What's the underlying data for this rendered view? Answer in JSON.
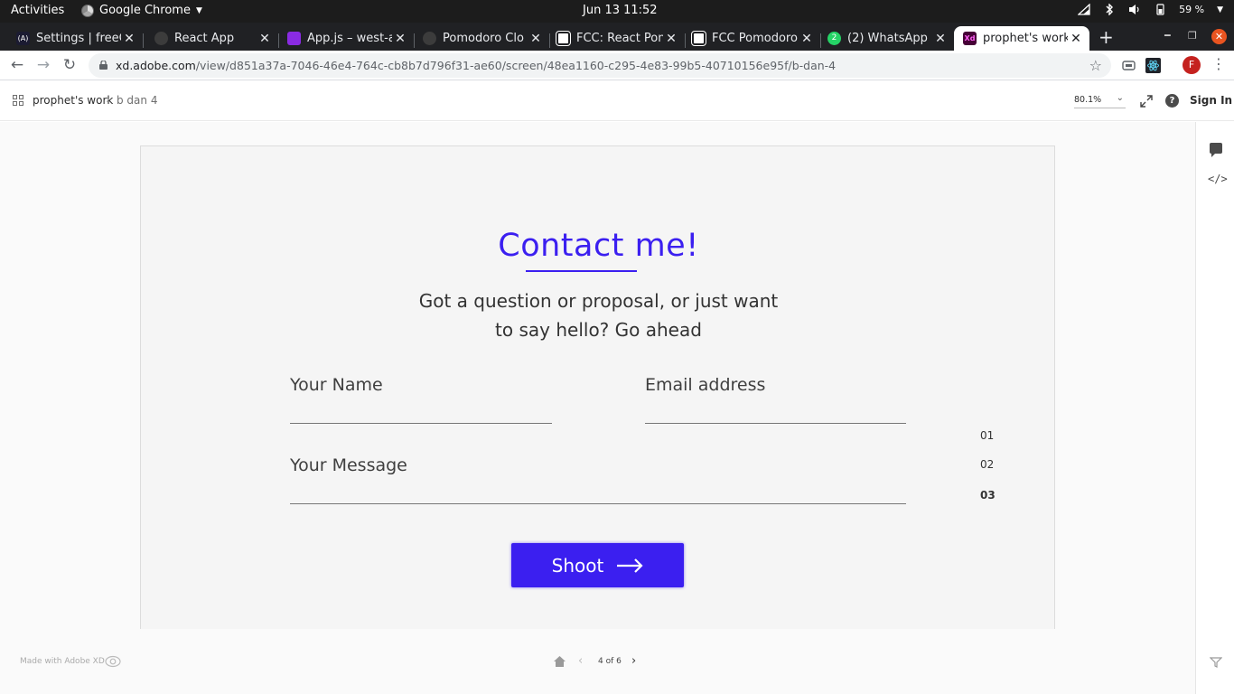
{
  "system_bar": {
    "activities": "Activities",
    "app_menu": "Google Chrome",
    "clock": "Jun 13  11:52",
    "battery": "59 %"
  },
  "tabs": [
    {
      "label": "Settings | freeC",
      "favicon_color": "#1b1b32"
    },
    {
      "label": "React App",
      "favicon_color": "#3c3c3c"
    },
    {
      "label": "App.js – west-a",
      "favicon_color": "#8a2be2"
    },
    {
      "label": "Pomodoro Clo",
      "favicon_color": "#3c3c3c"
    },
    {
      "label": "FCC: React Pon",
      "favicon_color": "#ffffff"
    },
    {
      "label": "FCC Pomodoro",
      "favicon_color": "#ffffff"
    },
    {
      "label": "(2) WhatsApp",
      "favicon_color": "#25d366",
      "badge": "2"
    },
    {
      "label": "prophet's work",
      "favicon_color": "#470137",
      "favicon_text": "Xd",
      "active": true
    }
  ],
  "address_bar": {
    "host": "xd.adobe.com",
    "path": "/view/d851a37a-7046-46e4-764c-cb8b7d796f31-ae60/screen/48ea1160-c295-4e83-99b5-40710156e95f/b-dan-4"
  },
  "profile_initial": "F",
  "xd_header": {
    "project": "prophet's work",
    "screen": "b dan 4",
    "zoom": "80.1%",
    "sign_in": "Sign In"
  },
  "artboard": {
    "title": "Contact me!",
    "subtitle_line1": "Got a question or proposal, or just want",
    "subtitle_line2": "to say hello? Go ahead",
    "name_placeholder": "Your Name",
    "email_placeholder": "Email address",
    "message_placeholder": "Your Message",
    "submit_label": "Shoot",
    "page_numbers": [
      "01",
      "02",
      "03"
    ],
    "accent_color": "#3b1ff0"
  },
  "footer": {
    "made_with": "Made with Adobe XD",
    "pager": "4 of 6"
  }
}
